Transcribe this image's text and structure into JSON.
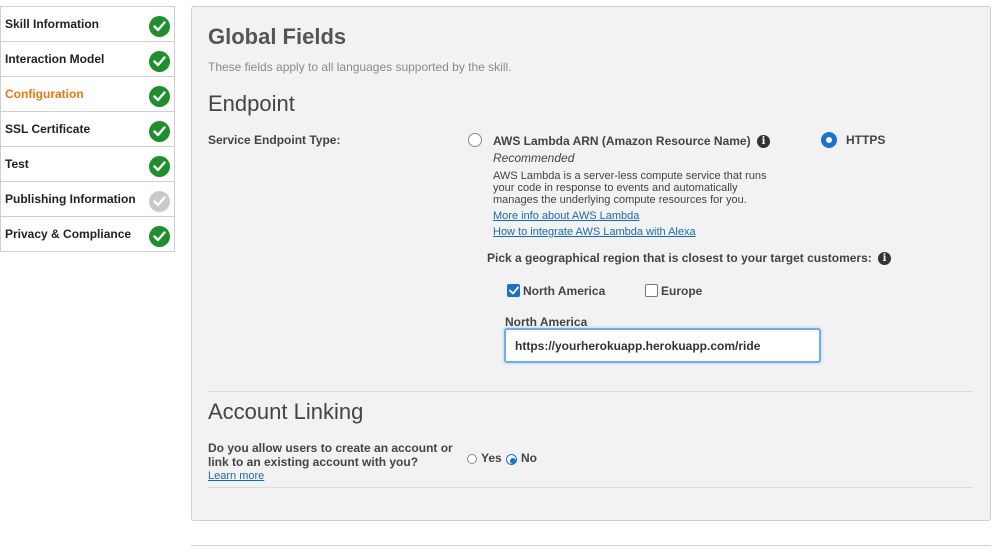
{
  "sidebar": {
    "items": [
      {
        "label": "Skill Information",
        "status": "complete"
      },
      {
        "label": "Interaction Model",
        "status": "complete"
      },
      {
        "label": "Configuration",
        "status": "complete",
        "active": true
      },
      {
        "label": "SSL Certificate",
        "status": "complete"
      },
      {
        "label": "Test",
        "status": "complete"
      },
      {
        "label": "Publishing Information",
        "status": "incomplete"
      },
      {
        "label": "Privacy & Compliance",
        "status": "complete"
      }
    ]
  },
  "global_fields": {
    "title": "Global Fields",
    "subtitle": "These fields apply to all languages supported by the skill."
  },
  "endpoint": {
    "title": "Endpoint",
    "type_label": "Service Endpoint Type:",
    "lambda_option": {
      "label": "AWS Lambda ARN (Amazon Resource Name)",
      "recommended": "Recommended",
      "description": "AWS Lambda is a server-less compute service that runs your code in response to events and automatically manages the underlying compute resources for you.",
      "link_more_info": "More info about AWS Lambda",
      "link_integrate": "How to integrate AWS Lambda with Alexa",
      "selected": false
    },
    "https_option": {
      "label": "HTTPS",
      "selected": true
    },
    "region_prompt": "Pick a geographical region that is closest to your target customers:",
    "regions": [
      {
        "label": "North America",
        "checked": true
      },
      {
        "label": "Europe",
        "checked": false
      }
    ],
    "north_america_label": "North America",
    "north_america_url": "https://yourherokuapp.herokuapp.com/ride"
  },
  "account_linking": {
    "title": "Account Linking",
    "question": "Do you allow users to create an account or link to an existing account with you?",
    "learn_more": "Learn more",
    "yes_label": "Yes",
    "no_label": "No",
    "selected": "No"
  },
  "colors": {
    "accent": "#e47911",
    "check_green": "#1e8f2c",
    "check_grey": "#c9c9c9",
    "link_blue": "#1a6bb5",
    "radio_blue": "#1a73c9"
  },
  "icons": {
    "complete": "check-circle-icon",
    "incomplete": "check-circle-grey-icon",
    "info": "info-icon"
  }
}
